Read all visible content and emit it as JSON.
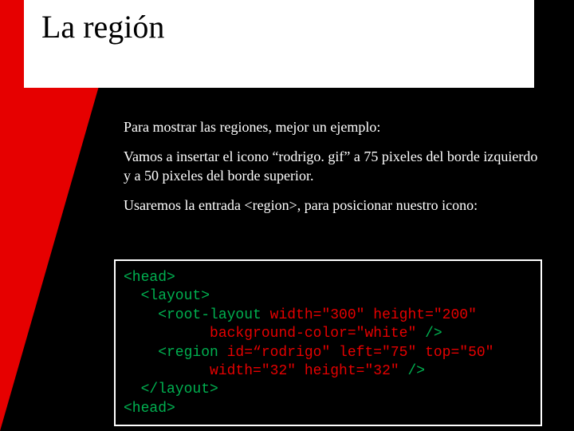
{
  "title": "La región",
  "body": {
    "p1": "Para mostrar las regiones, mejor un ejemplo:",
    "p2": "Vamos a insertar el icono “rodrigo. gif” a 75 pixeles del borde izquierdo y a 50 pixeles del borde superior.",
    "p3": "Usaremos la entrada <region>, para posicionar nuestro icono:"
  },
  "code": {
    "l1a": "<head>",
    "l2a": "  <layout>",
    "l3a": "    <root-layout ",
    "l3b": "width=\"300\" height=\"200\"",
    "l4a": "          ",
    "l4b": "background-color=\"white\"",
    "l4c": " />",
    "l5a": "    <region ",
    "l5b": "id=“rodrigo\" left=\"75\" top=\"50\"",
    "l6a": "          ",
    "l6b": "width=\"32\" height=\"32\"",
    "l6c": " />",
    "l7a": "  </layout>",
    "l8a": "<head>"
  }
}
